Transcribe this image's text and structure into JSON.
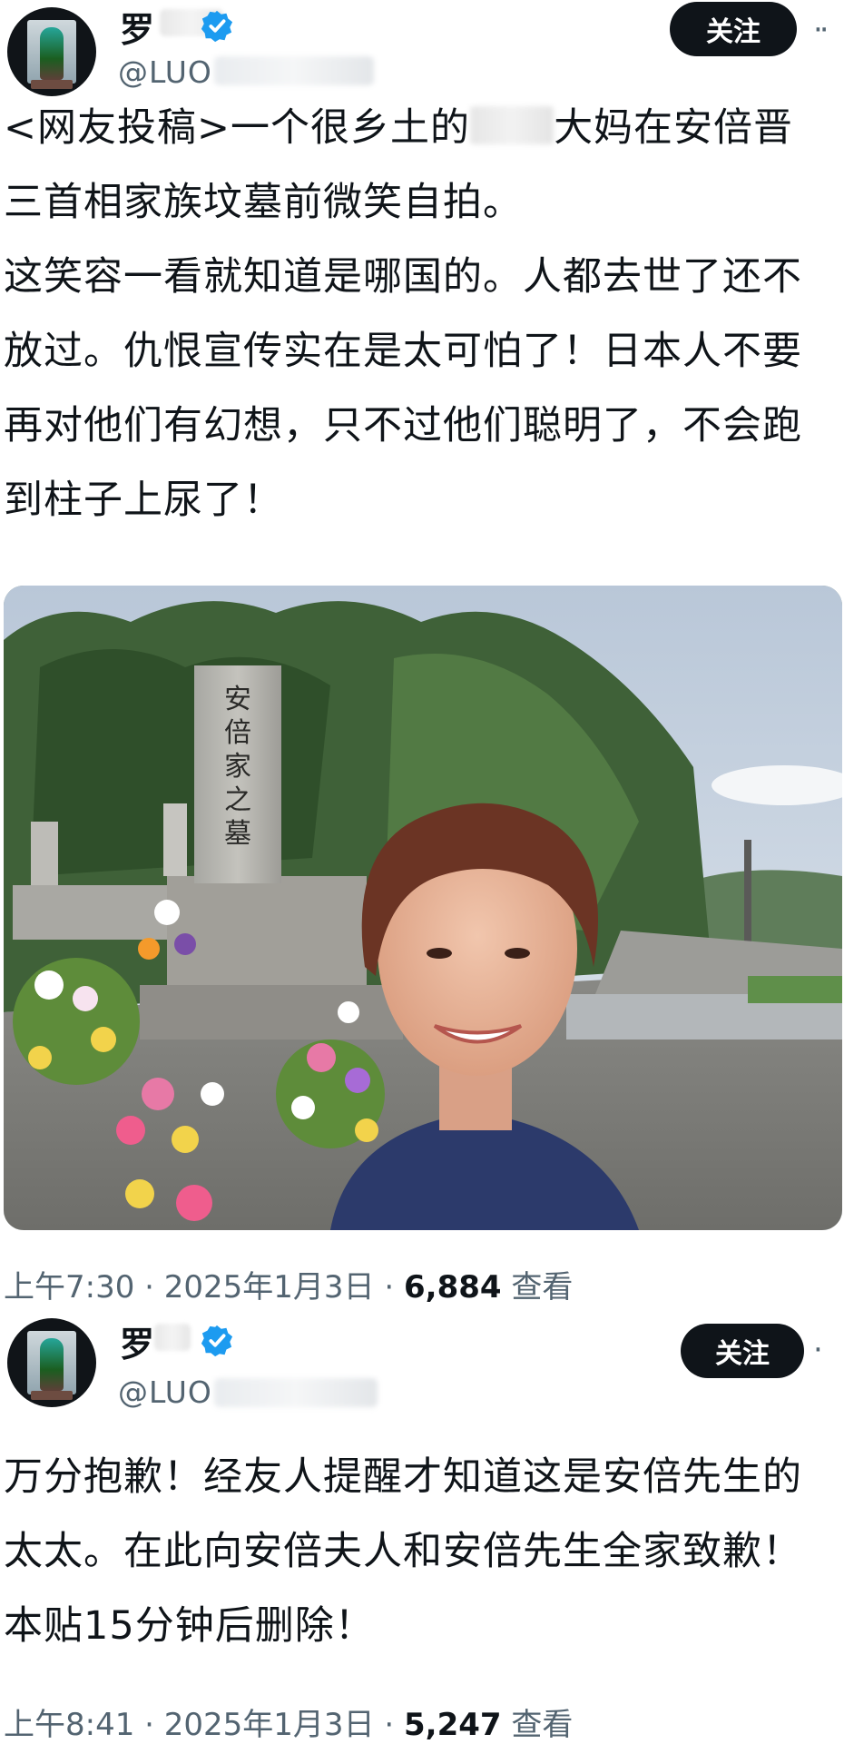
{
  "tweets": [
    {
      "display_name": "罗",
      "handle": "@LUO",
      "follow_label": "关注",
      "more_label": "··",
      "body_lines": [
        {
          "before": "<网友投稿>一个很乡土的",
          "after": "大妈在安倍晋"
        },
        {
          "text": "三首相家族坟墓前微笑自拍。"
        },
        {
          "text": "这笑容一看就知道是哪国的。人都去世了还不"
        },
        {
          "text": "放过。仇恨宣传实在是太可怕了！日本人不要"
        },
        {
          "text": "再对他们有幻想，只不过他们聪明了，不会跑"
        },
        {
          "text": "到柱子上尿了！"
        }
      ],
      "photo": {
        "tombstone_text": [
          "安",
          "倍",
          "家",
          "之",
          "墓"
        ]
      },
      "time": "上午7:30 · 2025年1月3日 · ",
      "views": "6,884",
      "views_label": " 查看"
    },
    {
      "display_name": "罗",
      "handle": "@LUO",
      "follow_label": "关注",
      "more_label": "·",
      "body_lines": [
        {
          "text": "万分抱歉！经友人提醒才知道这是安倍先生的"
        },
        {
          "text": "太太。在此向安倍夫人和安倍先生全家致歉！"
        },
        {
          "text": "本贴15分钟后删除！"
        }
      ],
      "time": "上午8:41 · 2025年1月3日 · ",
      "views": "5,247",
      "views_label": " 查看"
    }
  ],
  "colors": {
    "text_primary": "#0f1419",
    "text_secondary": "#536471",
    "verified_blue": "#1d9bf0",
    "follow_button_bg": "#0f1419"
  }
}
